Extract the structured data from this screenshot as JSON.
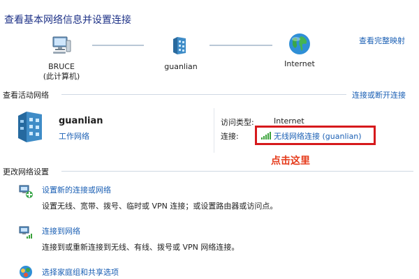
{
  "header": {
    "title": "查看基本网络信息并设置连接",
    "full_map_link": "查看完整映射"
  },
  "network_map": {
    "computer": {
      "name": "BRUCE",
      "subtitle": "(此计算机)",
      "icon": "computer-icon"
    },
    "network": {
      "name": "guanlian",
      "icon": "network-building-icon"
    },
    "internet": {
      "name": "Internet",
      "icon": "globe-icon"
    }
  },
  "active_networks": {
    "section_label": "查看活动网络",
    "connect_link": "连接或断开连接",
    "network": {
      "name": "guanlian",
      "type_link": "工作网络",
      "access_type_label": "访问类型:",
      "access_type_value": "Internet",
      "connection_label": "连接:",
      "connection_link": "无线网络连接 (guanlian)",
      "signal_icon": "wifi-signal-icon"
    },
    "annotation": "点击这里",
    "highlight_color": "#d6191c"
  },
  "change_settings": {
    "section_label": "更改网络设置",
    "tasks": [
      {
        "title": "设置新的连接或网络",
        "description": "设置无线、宽带、拨号、临时或 VPN 连接；或设置路由器或访问点。",
        "icon": "new-connection-icon"
      },
      {
        "title": "连接到网络",
        "description": "连接到或重新连接到无线、有线、拨号或 VPN 网络连接。",
        "icon": "connect-network-icon"
      },
      {
        "title": "选择家庭组和共享选项",
        "description": "",
        "icon": "homegroup-icon"
      }
    ]
  },
  "colors": {
    "link": "#1a5fb4",
    "title": "#1e3287",
    "annotation": "#e53a1a"
  }
}
